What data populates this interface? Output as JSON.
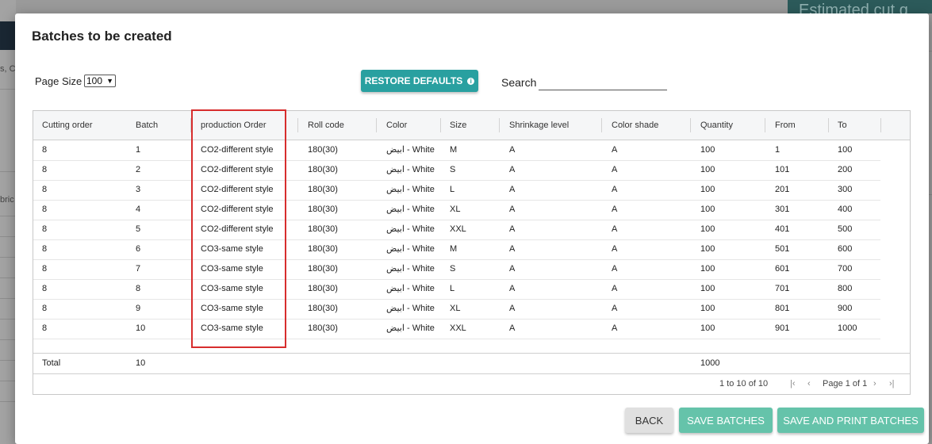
{
  "background": {
    "left_text_1": "s, CO",
    "left_text_2": "bric",
    "teal_banner_text": "Estimated cut q"
  },
  "modal": {
    "title": "Batches to be created",
    "page_size_label": "Page Size",
    "page_size_value": "100",
    "restore_defaults_label": "RESTORE DEFAULTS",
    "search_label": "Search",
    "search_value": ""
  },
  "grid": {
    "columns": [
      "Cutting order",
      "Batch",
      "production Order",
      "Roll code",
      "Color",
      "Size",
      "Shrinkage level",
      "Color shade",
      "Quantity",
      "From",
      "To"
    ],
    "rows": [
      [
        "8",
        "1",
        "CO2-different style",
        "180(30)",
        "ابيض - White",
        "M",
        "A",
        "A",
        "100",
        "1",
        "100"
      ],
      [
        "8",
        "2",
        "CO2-different style",
        "180(30)",
        "ابيض - White",
        "S",
        "A",
        "A",
        "100",
        "101",
        "200"
      ],
      [
        "8",
        "3",
        "CO2-different style",
        "180(30)",
        "ابيض - White",
        "L",
        "A",
        "A",
        "100",
        "201",
        "300"
      ],
      [
        "8",
        "4",
        "CO2-different style",
        "180(30)",
        "ابيض - White",
        "XL",
        "A",
        "A",
        "100",
        "301",
        "400"
      ],
      [
        "8",
        "5",
        "CO2-different style",
        "180(30)",
        "ابيض - White",
        "XXL",
        "A",
        "A",
        "100",
        "401",
        "500"
      ],
      [
        "8",
        "6",
        "CO3-same style",
        "180(30)",
        "ابيض - White",
        "M",
        "A",
        "A",
        "100",
        "501",
        "600"
      ],
      [
        "8",
        "7",
        "CO3-same style",
        "180(30)",
        "ابيض - White",
        "S",
        "A",
        "A",
        "100",
        "601",
        "700"
      ],
      [
        "8",
        "8",
        "CO3-same style",
        "180(30)",
        "ابيض - White",
        "L",
        "A",
        "A",
        "100",
        "701",
        "800"
      ],
      [
        "8",
        "9",
        "CO3-same style",
        "180(30)",
        "ابيض - White",
        "XL",
        "A",
        "A",
        "100",
        "801",
        "900"
      ],
      [
        "8",
        "10",
        "CO3-same style",
        "180(30)",
        "ابيض - White",
        "XXL",
        "A",
        "A",
        "100",
        "901",
        "1000"
      ]
    ],
    "total": {
      "label": "Total",
      "batch": "10",
      "quantity": "1000"
    },
    "pager": {
      "summary": "1 to 10 of 10",
      "page_text": "Page 1 of 1"
    }
  },
  "footer": {
    "back_label": "BACK",
    "save_label": "SAVE BATCHES",
    "save_print_label": "SAVE AND PRINT BATCHES"
  },
  "colors": {
    "accent": "#29a0a0",
    "save_button": "#65c3aa",
    "highlight_border": "#d72d2d"
  }
}
